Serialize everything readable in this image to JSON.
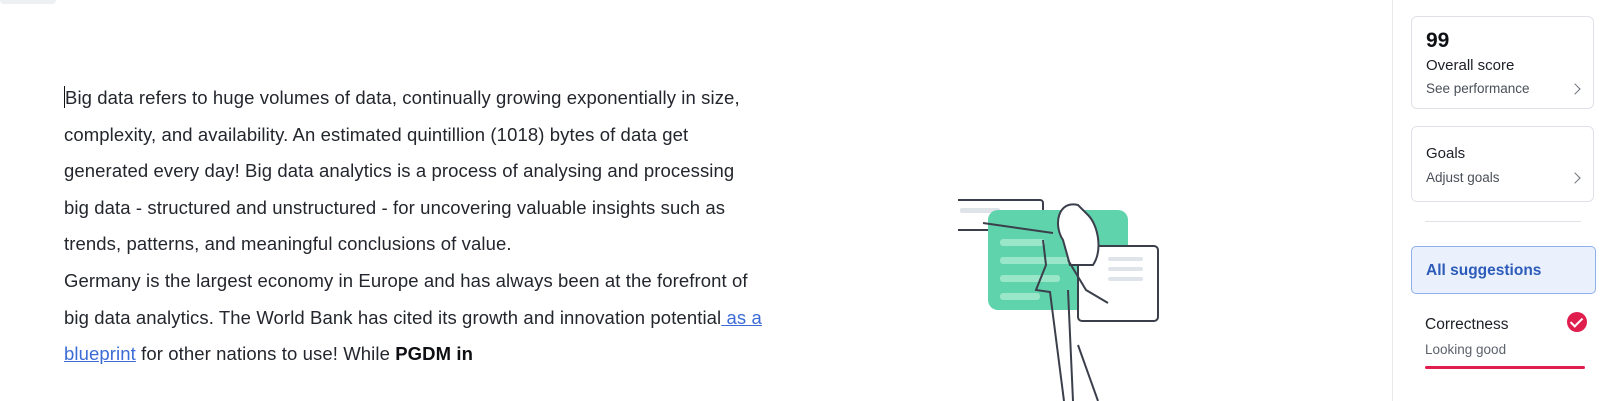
{
  "editor": {
    "paragraph1": "Big data refers to huge volumes of data, continually growing exponentially in size, complexity, and availability. An estimated quintillion (1018) bytes of data get generated every day! Big data analytics is a process of analysing and processing big data - structured and unstructured - for uncovering valuable insights such as trends, patterns, and meaningful conclusions of value.",
    "paragraph2_before_link": "Germany is the largest economy in Europe and has always been at the forefront of big data analytics. The World Bank has cited its growth and innovation potential",
    "paragraph2_link": " as a blueprint",
    "paragraph2_after_link": " for other nations to use! While ",
    "paragraph2_bold": "PGDM in"
  },
  "sidebar": {
    "score": {
      "value": "99",
      "title": "Overall score",
      "subtitle": "See performance"
    },
    "goals": {
      "title": "Goals",
      "subtitle": "Adjust goals"
    },
    "all_suggestions": "All suggestions",
    "correctness": {
      "title": "Correctness",
      "subtitle": "Looking good"
    }
  },
  "colors": {
    "accent_blue": "#2d5bb9",
    "link_blue": "#3b6bd6",
    "alert_red": "#e01e4e",
    "illustration_green": "#5fd3ab"
  },
  "icons": [
    "chevron-right-icon",
    "check-circle-icon",
    "woman-presenting-illustration"
  ]
}
